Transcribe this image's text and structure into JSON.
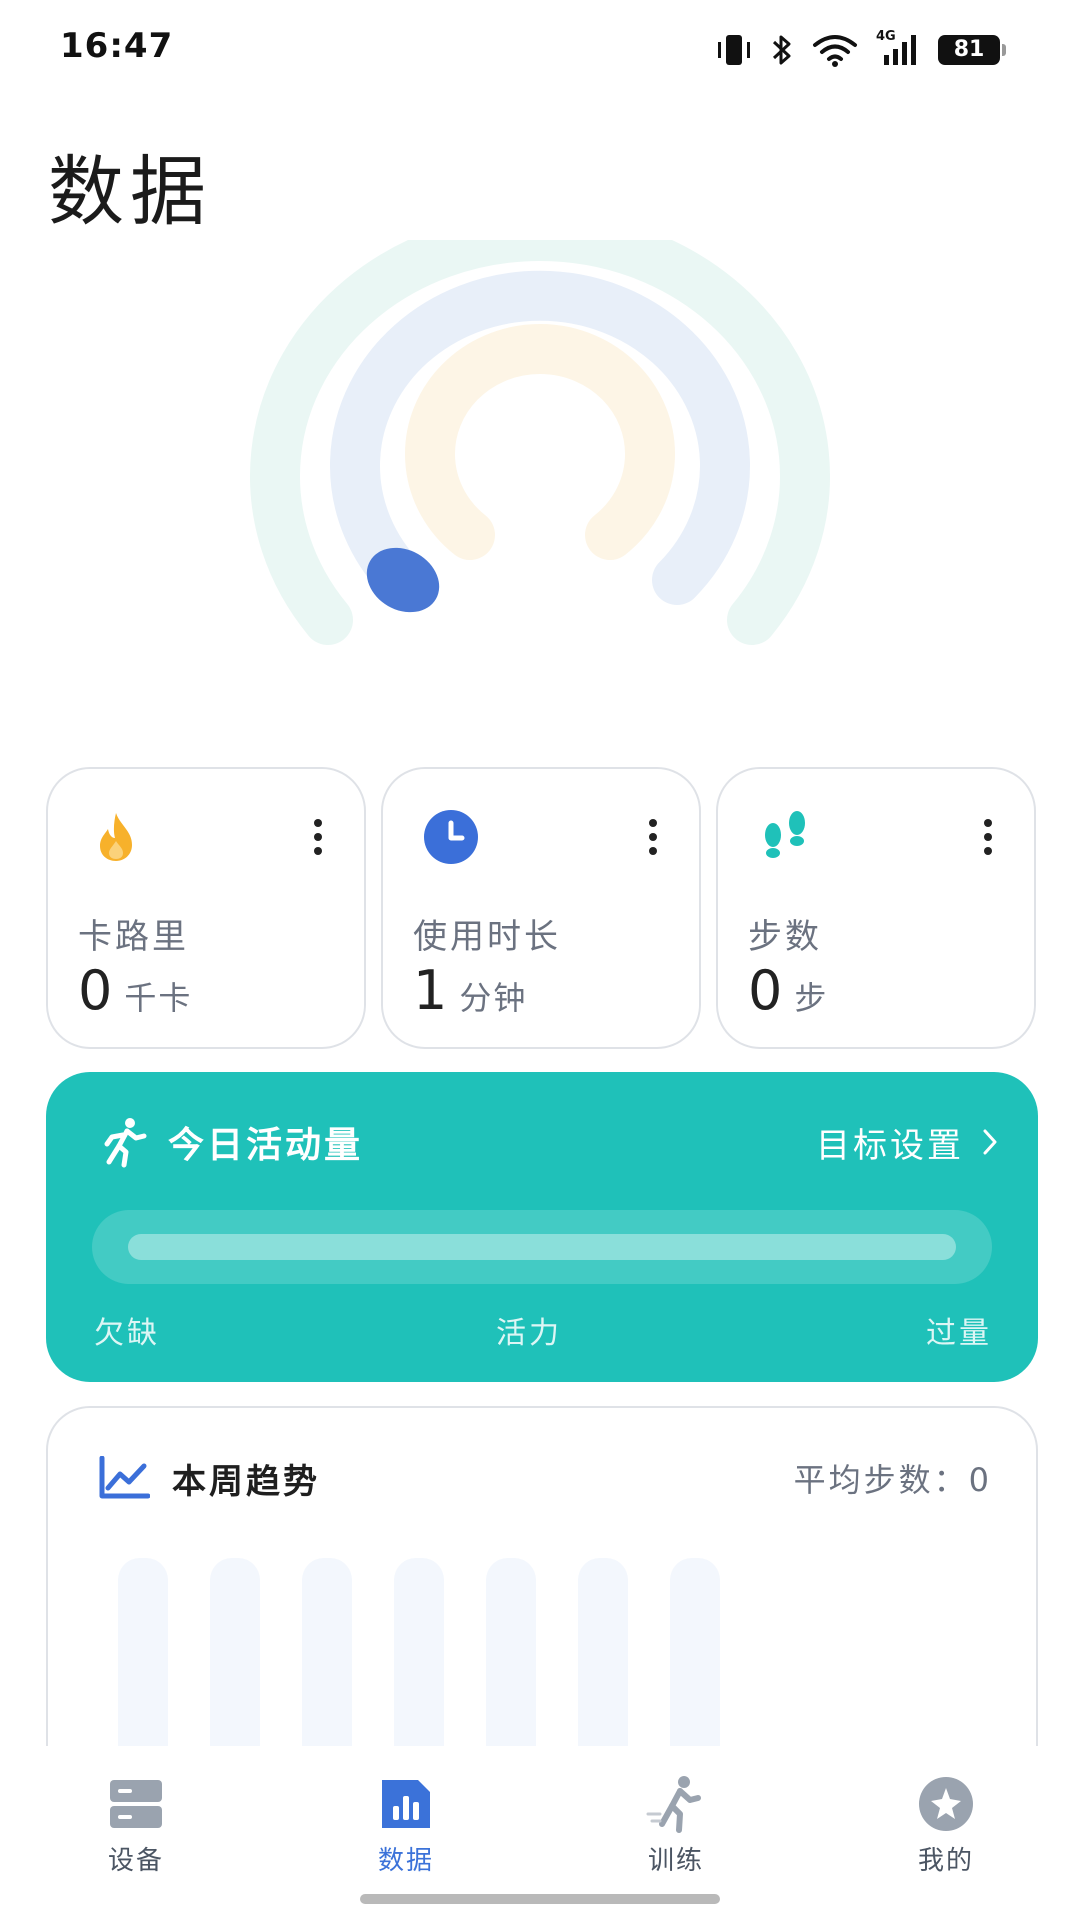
{
  "status_bar": {
    "time": "16:47",
    "network": "4G",
    "battery": "81",
    "icons": [
      "vibrate-icon",
      "bluetooth-icon",
      "wifi-icon",
      "cellular-signal-icon",
      "battery-icon"
    ]
  },
  "page": {
    "title": "数据"
  },
  "rings": {
    "calories_progress": 0,
    "duration_progress": 0.02,
    "steps_progress": 0,
    "colors": {
      "outer": "#eaf7f4",
      "middle": "#e8eff9",
      "inner": "#fdf5e6",
      "indicator": "#4a78d4"
    }
  },
  "metrics": [
    {
      "icon": "flame-icon",
      "label": "卡路里",
      "value": "0",
      "unit": "千卡",
      "color": "#f7b12b"
    },
    {
      "icon": "clock-icon",
      "label": "使用时长",
      "value": "1",
      "unit": "分钟",
      "color": "#3b6fd9"
    },
    {
      "icon": "footprints-icon",
      "label": "步数",
      "value": "0",
      "unit": "步",
      "color": "#1fc1b9"
    }
  ],
  "activity": {
    "icon": "running-person-icon",
    "title": "今日活动量",
    "goal_link": "目标设置",
    "level": 0,
    "scale": {
      "low": "欠缺",
      "mid": "活力",
      "high": "过量"
    },
    "color": "#1fc1b9"
  },
  "trend": {
    "icon": "trend-chart-icon",
    "title": "本周趋势",
    "average": "平均步数：0",
    "bar_count": 7,
    "values": [
      0,
      0,
      0,
      0,
      0,
      0,
      0
    ]
  },
  "nav": {
    "items": [
      {
        "icon": "device-icon",
        "label": "设备",
        "active": false
      },
      {
        "icon": "bar-chart-icon",
        "label": "数据",
        "active": true
      },
      {
        "icon": "training-icon",
        "label": "训练",
        "active": false
      },
      {
        "icon": "profile-icon",
        "label": "我的",
        "active": false
      }
    ],
    "active_color": "#3b72d9"
  }
}
